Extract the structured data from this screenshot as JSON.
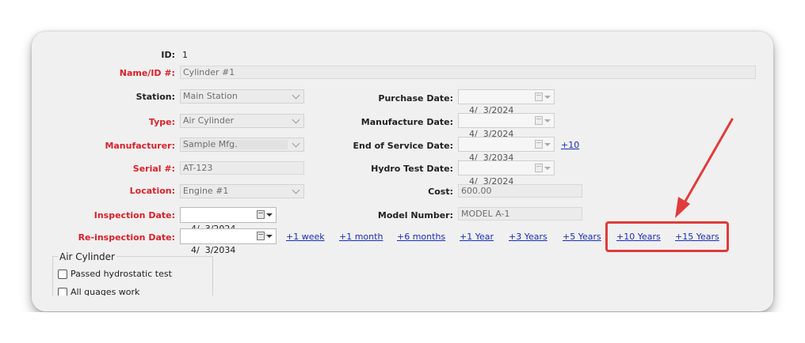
{
  "form": {
    "id_label": "ID:",
    "id_value": "1",
    "name_label": "Name/ID #:",
    "name_value": "Cylinder #1",
    "station_label": "Station:",
    "station_value": "Main Station",
    "type_label": "Type:",
    "type_value": "Air Cylinder",
    "manufacturer_label": "Manufacturer:",
    "manufacturer_value": "Sample Mfg.",
    "serial_label": "Serial #:",
    "serial_value": "AT-123",
    "location_label": "Location:",
    "location_value": "Engine #1",
    "inspection_date_label": "Inspection Date:",
    "inspection_date_value": "4/  3/2024",
    "reinspection_date_label": "Re-inspection Date:",
    "reinspection_date_value": "4/  3/2034",
    "purchase_date_label": "Purchase Date:",
    "purchase_date_value": "4/  3/2024",
    "manufacture_date_label": "Manufacture Date:",
    "manufacture_date_value": "4/  3/2024",
    "end_of_service_label": "End of Service Date:",
    "end_of_service_value": "4/  3/2034",
    "end_of_service_link": "+10",
    "hydro_test_label": "Hydro Test Date:",
    "hydro_test_value": "4/  3/2024",
    "cost_label": "Cost:",
    "cost_value": "600.00",
    "model_label": "Model Number:",
    "model_value": "MODEL A-1"
  },
  "quick_links": [
    "+1 week",
    "+1 month",
    "+6 months",
    "+1 Year",
    "+3 Years",
    "+5 Years",
    "+10 Years",
    "+15 Years"
  ],
  "checklist": {
    "legend": "Air Cylinder",
    "items": [
      "Passed hydrostatic test",
      "All guages work"
    ]
  },
  "colors": {
    "required_label": "#d8222a",
    "link": "#1a2fb0",
    "highlight": "#e03b3b"
  }
}
